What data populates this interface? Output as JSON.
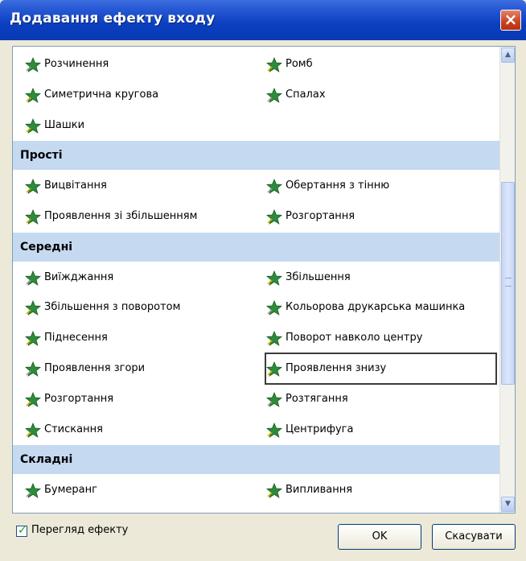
{
  "window": {
    "title": "Додавання ефекту входу",
    "close_label": "×"
  },
  "rows": [
    {
      "left": {
        "label": "Розчинення",
        "icon": "dissolve-star-icon"
      },
      "right": {
        "label": "Ромб",
        "icon": "diamond-star-icon"
      }
    },
    {
      "left": {
        "label": "Симетрична кругова",
        "icon": "split-star-icon"
      },
      "right": {
        "label": "Спалах",
        "icon": "flash-star-icon"
      }
    },
    {
      "left": {
        "label": "Шашки",
        "icon": "checkerboard-star-icon"
      },
      "right": null
    }
  ],
  "groups": [
    {
      "header": "Прості",
      "rows": [
        {
          "left": {
            "label": "Вицвітання"
          },
          "right": {
            "label": "Обертання з тінню"
          }
        },
        {
          "left": {
            "label": "Проявлення зі збільшенням"
          },
          "right": {
            "label": "Розгортання"
          }
        }
      ]
    },
    {
      "header": "Середні",
      "rows": [
        {
          "left": {
            "label": "Виїжджання"
          },
          "right": {
            "label": "Збільшення"
          }
        },
        {
          "left": {
            "label": "Збільшення з поворотом"
          },
          "right": {
            "label": "Кольорова друкарська машинка"
          }
        },
        {
          "left": {
            "label": "Піднесення"
          },
          "right": {
            "label": "Поворот навколо центру"
          }
        },
        {
          "left": {
            "label": "Проявлення згори"
          },
          "right": {
            "label": "Проявлення знизу",
            "selected": true
          }
        },
        {
          "left": {
            "label": "Розгортання"
          },
          "right": {
            "label": "Розтягання"
          }
        },
        {
          "left": {
            "label": "Стискання"
          },
          "right": {
            "label": "Центрифуга"
          }
        }
      ]
    },
    {
      "header": "Складні",
      "rows": [
        {
          "left": {
            "label": "Бумеранг"
          },
          "right": {
            "label": "Випливання"
          }
        }
      ]
    }
  ],
  "footer": {
    "preview_label": "Перегляд ефекту",
    "preview_checked": true,
    "ok_label": "OK",
    "cancel_label": "Скасувати"
  },
  "colors": {
    "header_bg": "#c5d9f1",
    "title_bar": "#0a3fc0",
    "star_green": "#2e8b3a"
  }
}
